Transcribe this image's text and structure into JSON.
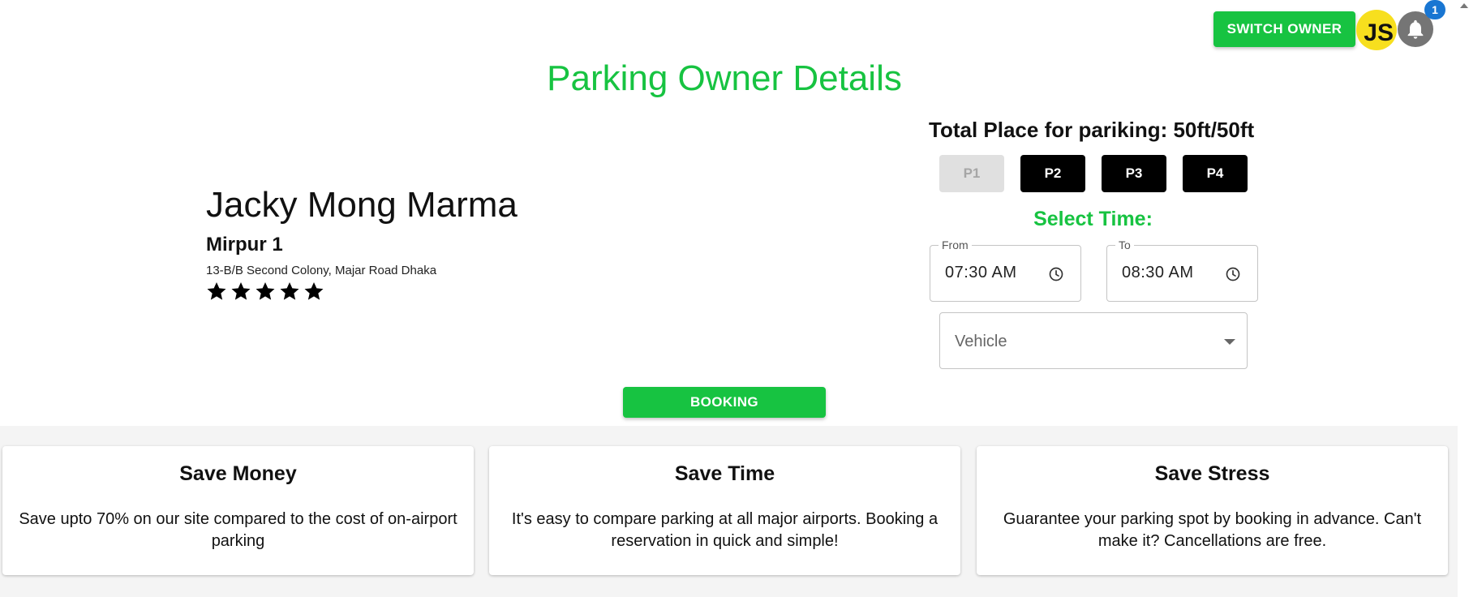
{
  "header": {
    "switch_owner_label": "SWITCH OWNER",
    "avatar_text": "JS",
    "notification_count": "1"
  },
  "page_title": "Parking Owner Details",
  "owner": {
    "name": "Jacky Mong Marma",
    "area": "Mirpur 1",
    "address": "13-B/B Second Colony, Majar Road Dhaka",
    "rating": 5,
    "rating_max": 5
  },
  "parking": {
    "total_place": "Total Place for pariking: 50ft/50ft",
    "slots": [
      {
        "label": "P1",
        "state": "disabled"
      },
      {
        "label": "P2",
        "state": "active"
      },
      {
        "label": "P3",
        "state": "active"
      },
      {
        "label": "P4",
        "state": "active"
      }
    ],
    "select_time_label": "Select Time:",
    "from": {
      "label": "From",
      "value": "07:30 AM"
    },
    "to": {
      "label": "To",
      "value": "08:30 AM"
    },
    "vehicle_placeholder": "Vehicle"
  },
  "booking_label": "BOOKING",
  "features": [
    {
      "title": "Save Money",
      "text": "Save upto 70% on our site compared to the cost of on-airport parking"
    },
    {
      "title": "Save Time",
      "text": "It's easy to compare parking at all major airports. Booking a reservation in quick and simple!"
    },
    {
      "title": "Save Stress",
      "text": "Guarantee your parking spot by booking in advance. Can't make it? Cancellations are free."
    }
  ],
  "colors": {
    "brand_green": "#17c341",
    "slot_active": "#000000",
    "slot_disabled": "#e0e0e0",
    "badge_blue": "#1976d2",
    "avatar_yellow": "#f7df1e"
  },
  "icons": [
    "bell-icon",
    "clock-icon",
    "star-icon",
    "chevron-down-icon"
  ]
}
